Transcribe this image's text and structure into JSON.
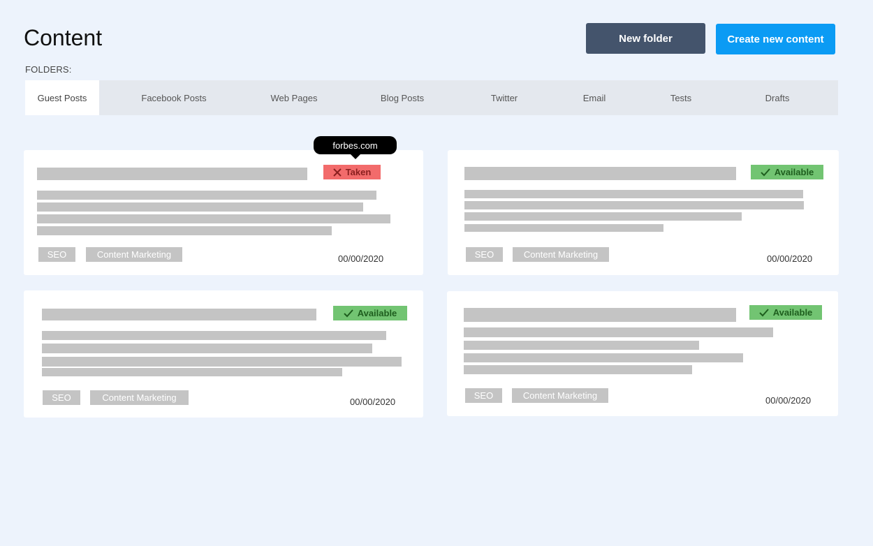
{
  "header": {
    "title": "Content",
    "new_folder_label": "New folder",
    "create_label": "Create new content"
  },
  "folders_label": "FOLDERS:",
  "tabs": [
    {
      "label": "Guest Posts",
      "active": true
    },
    {
      "label": "Facebook Posts",
      "active": false
    },
    {
      "label": "Web Pages",
      "active": false
    },
    {
      "label": "Blog Posts",
      "active": false
    },
    {
      "label": "Twitter",
      "active": false
    },
    {
      "label": "Email",
      "active": false
    },
    {
      "label": "Tests",
      "active": false
    },
    {
      "label": "Drafts",
      "active": false
    }
  ],
  "tooltip": {
    "text": "forbes.com"
  },
  "cards": [
    {
      "status": "Taken",
      "status_type": "taken",
      "tags": [
        "SEO",
        "Content Marketing"
      ],
      "date": "00/00/2020"
    },
    {
      "status": "Available",
      "status_type": "available",
      "tags": [
        "SEO",
        "Content Marketing"
      ],
      "date": "00/00/2020"
    },
    {
      "status": "Available",
      "status_type": "available",
      "tags": [
        "SEO",
        "Content Marketing"
      ],
      "date": "00/00/2020"
    },
    {
      "status": "Available",
      "status_type": "available",
      "tags": [
        "SEO",
        "Content Marketing"
      ],
      "date": "00/00/2020"
    }
  ],
  "colors": {
    "background": "#edf3fc",
    "new_folder_button": "#44546c",
    "create_button": "#0b9bf4",
    "taken_badge": "#f26b6b",
    "available_badge": "#72c472",
    "placeholder_bar": "#c4c4c4"
  },
  "icons": {
    "taken": "x-icon",
    "available": "checkmark-icon"
  }
}
